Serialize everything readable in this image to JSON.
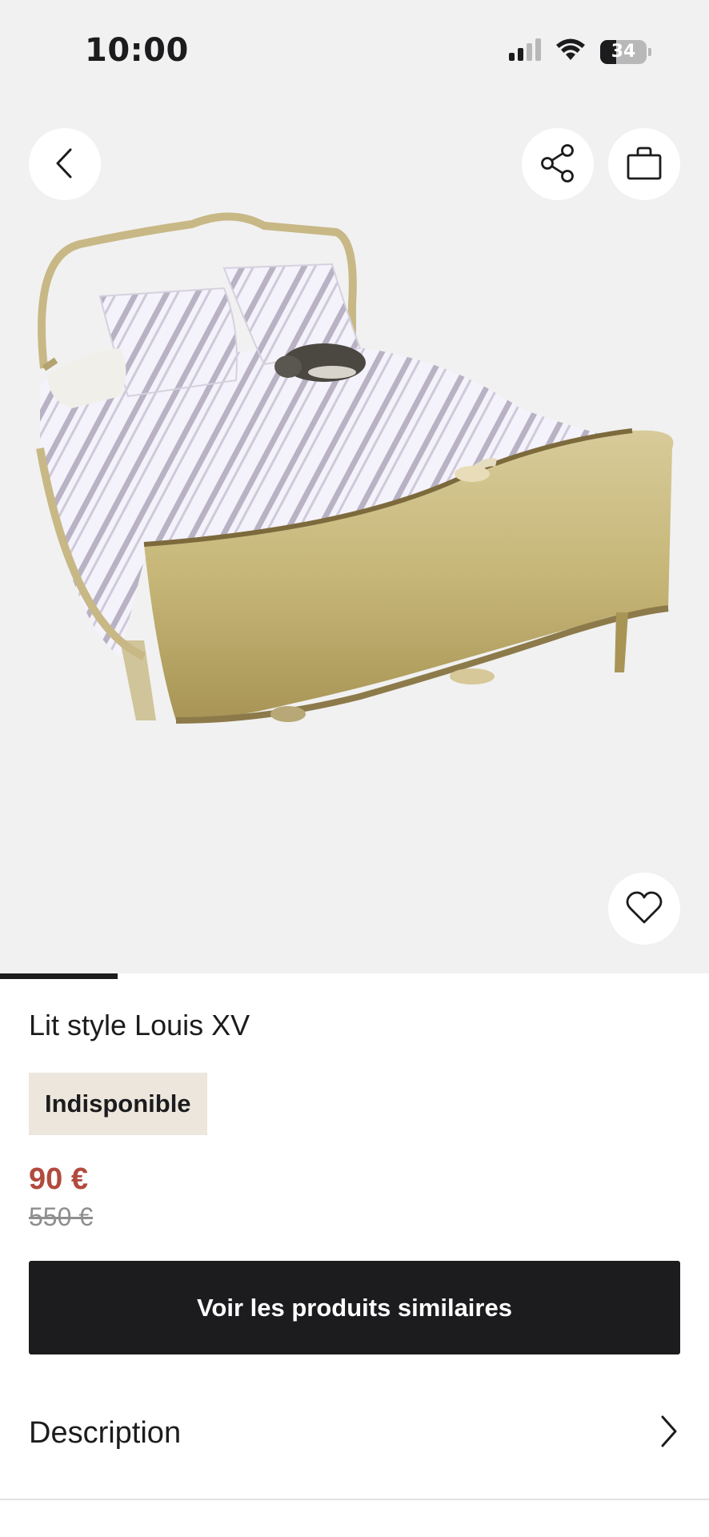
{
  "status_bar": {
    "time": "10:00",
    "battery_level": "34",
    "battery_fraction": 0.34,
    "icons": [
      "signal-icon",
      "wifi-icon",
      "battery-icon"
    ]
  },
  "toolbar": {
    "back_icon": "chevron-left-icon",
    "share_icon": "share-icon",
    "bag_icon": "shopping-bag-icon",
    "favorite_icon": "heart-icon"
  },
  "gallery": {
    "progress_fraction": 0.166
  },
  "product": {
    "title": "Lit style Louis XV",
    "availability": "Indisponible",
    "price": "90 €",
    "original_price": "550 €"
  },
  "actions": {
    "similar_products_label": "Voir les produits similaires"
  },
  "sections": {
    "description_label": "Description",
    "description_icon": "chevron-right-icon"
  },
  "colors": {
    "price": "#b24a3e",
    "badge_background": "#ece6dc",
    "cta_background": "#1c1c1e",
    "hero_background": "#f1f1f1"
  }
}
